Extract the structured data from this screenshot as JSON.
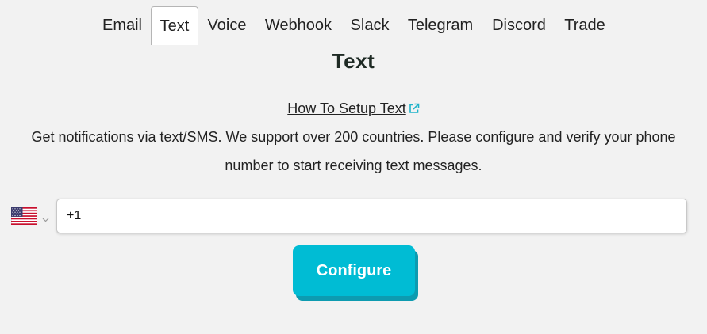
{
  "tabs": [
    {
      "label": "Email",
      "active": false
    },
    {
      "label": "Text",
      "active": true
    },
    {
      "label": "Voice",
      "active": false
    },
    {
      "label": "Webhook",
      "active": false
    },
    {
      "label": "Slack",
      "active": false
    },
    {
      "label": "Telegram",
      "active": false
    },
    {
      "label": "Discord",
      "active": false
    },
    {
      "label": "Trade",
      "active": false
    }
  ],
  "main": {
    "title": "Text",
    "setup_link": "How To Setup Text",
    "description_line1": "Get notifications via text/SMS. We support over 200 countries. Please configure and verify your phone",
    "description_line2": "number to start receiving text messages."
  },
  "phone": {
    "country_flag": "us-flag-icon",
    "value": "+1"
  },
  "configure_button": {
    "label": "Configure"
  },
  "colors": {
    "background": "#f2f2f2",
    "button": "#00bcd4",
    "button_shadow": "#0d9bb0",
    "link_icon": "#1fb3c9"
  }
}
